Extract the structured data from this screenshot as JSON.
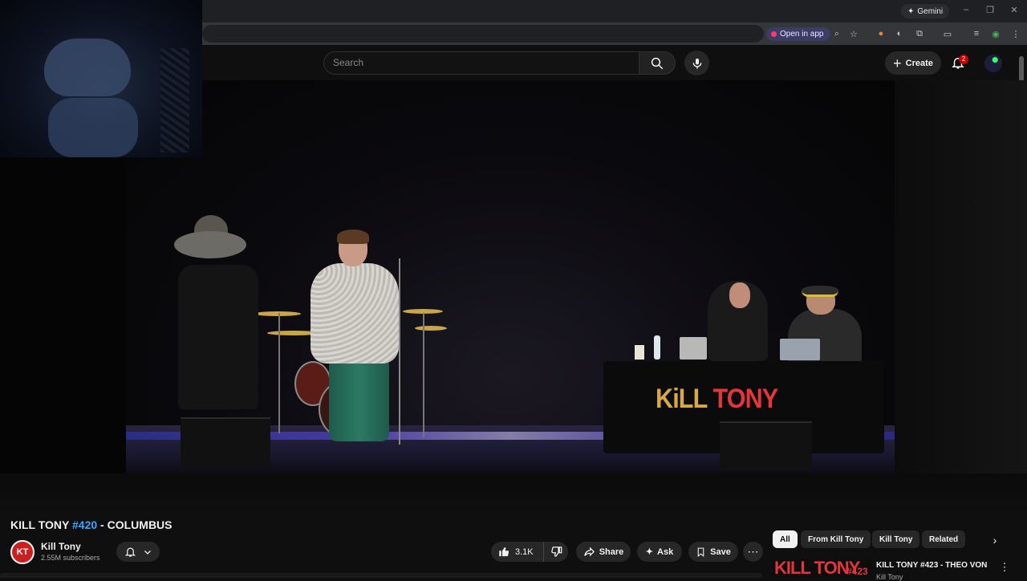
{
  "browser": {
    "gemini_label": "Gemini",
    "open_app_label": "Open in app",
    "window_controls": [
      "–",
      "❐",
      "✕"
    ]
  },
  "youtube": {
    "search": {
      "placeholder": "Search"
    },
    "create_label": "Create",
    "notifications_count": "2"
  },
  "video": {
    "stage_banner_left": "KiLL",
    "stage_banner_right": "TONY"
  },
  "watch": {
    "title_prefix": "KILL TONY ",
    "title_hashtag": "#420",
    "title_suffix": " - COLUMBUS",
    "channel": {
      "avatar_text": "KT",
      "name": "Kill Tony",
      "subscribers": "2.55M subscribers"
    },
    "actions": {
      "like_count": "3.1K",
      "share_label": "Share",
      "ask_label": "Ask",
      "save_label": "Save"
    }
  },
  "sidebar": {
    "chips": [
      "All",
      "From Kill Tony",
      "Kill Tony",
      "Related"
    ],
    "recommendation": {
      "thumb_text": "KILL TONY",
      "thumb_number": "#423",
      "title": "KILL TONY #423 - THEO VON",
      "channel": "Kill Tony"
    }
  }
}
